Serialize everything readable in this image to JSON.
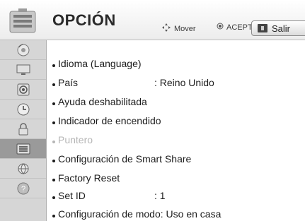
{
  "header": {
    "title": "OPCIÓN",
    "hint_move": "Mover",
    "hint_ok": "ACEPTAR",
    "exit_label": "Salir"
  },
  "sidebar": {
    "items": [
      {
        "name": "picture",
        "icon": "disc-icon"
      },
      {
        "name": "screen",
        "icon": "monitor-icon"
      },
      {
        "name": "sound",
        "icon": "speaker-icon"
      },
      {
        "name": "time",
        "icon": "clock-icon"
      },
      {
        "name": "lock",
        "icon": "lock-icon"
      },
      {
        "name": "option",
        "icon": "option-icon",
        "active": true
      },
      {
        "name": "network",
        "icon": "network-icon"
      },
      {
        "name": "support",
        "icon": "help-icon"
      }
    ]
  },
  "menu": {
    "items": [
      {
        "label": "Idioma (Language)",
        "value": ""
      },
      {
        "label": "País",
        "value": ": Reino Unido"
      },
      {
        "label": "Ayuda deshabilitada",
        "value": ""
      },
      {
        "label": "Indicador de encendido",
        "value": ""
      },
      {
        "label": "Puntero",
        "value": "",
        "disabled": true
      },
      {
        "label": "Configuración de Smart Share",
        "value": ""
      },
      {
        "label": "Factory Reset",
        "value": ""
      },
      {
        "label": "Set ID",
        "value": ": 1"
      },
      {
        "label": "Configuración de modo: Uso en casa",
        "value": ""
      }
    ]
  },
  "colors": {
    "sidebar_bg": "#d6d6d6",
    "sidebar_active": "#9a9a9a",
    "disabled_text": "#b6b6b6"
  }
}
